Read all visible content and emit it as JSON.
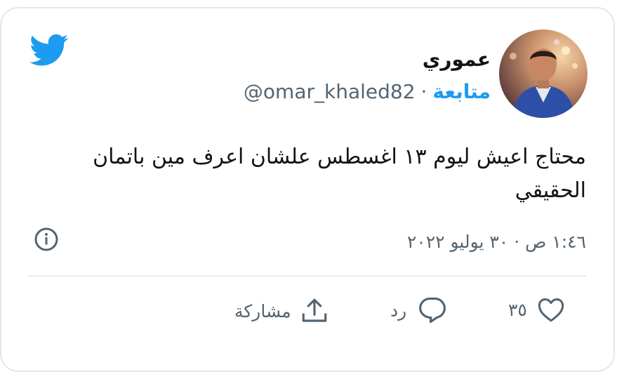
{
  "tweet": {
    "display_name": "عموري",
    "handle": "@omar_khaled82",
    "follow_label": "متابعة",
    "separator": "·",
    "text": "محتاج اعيش ليوم ١٣ اغسطس علشان اعرف مين باتمان الحقيقي",
    "timestamp": "١:٤٦ ص · ٣٠ يوليو ٢٠٢٢"
  },
  "actions": {
    "like_count": "٣٥",
    "reply_label": "رد",
    "share_label": "مشاركة"
  },
  "icons": {
    "brand": "twitter-bird-icon",
    "info": "info-icon",
    "like": "heart-icon",
    "reply": "speech-bubble-icon",
    "share": "share-upload-icon"
  },
  "colors": {
    "brand": "#1d9bf0",
    "secondary_text": "#536471",
    "primary_text": "#0f1419",
    "border": "#e1e8ed"
  }
}
